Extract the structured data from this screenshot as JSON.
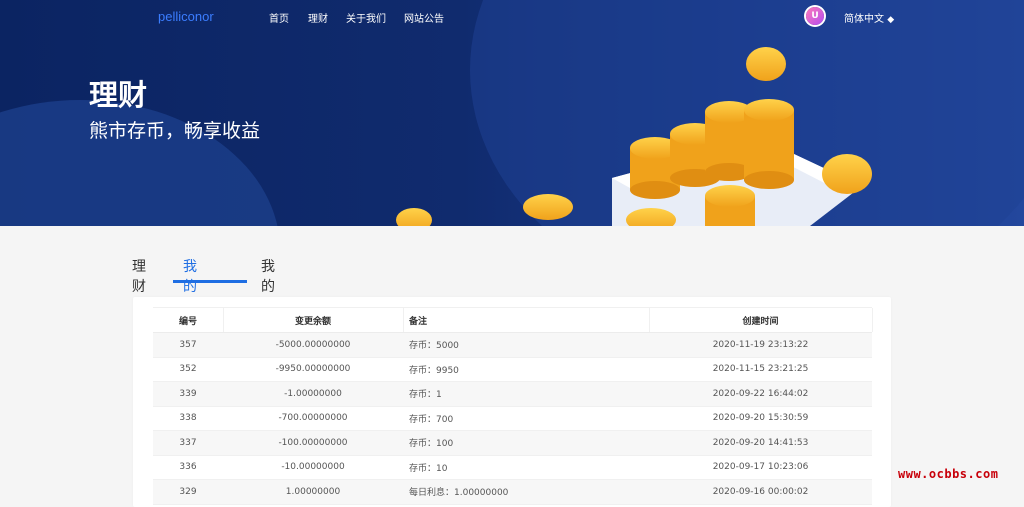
{
  "nav": {
    "logo": "pelliconor",
    "items": [
      "首页",
      "理财",
      "关于我们",
      "网站公告"
    ],
    "language": "简体中文"
  },
  "hero": {
    "title": "理财",
    "subtitle": "熊市存币，畅享收益"
  },
  "tabs": {
    "items": [
      "理财",
      "我的理财",
      "我的订单"
    ],
    "active": "我的理财"
  },
  "table": {
    "headers": [
      "编号",
      "变更余额",
      "备注",
      "创建时间"
    ],
    "rows": [
      [
        "357",
        "-5000.00000000",
        "存币：5000",
        "2020-11-19 23:13:22"
      ],
      [
        "352",
        "-9950.00000000",
        "存币：9950",
        "2020-11-15 23:21:25"
      ],
      [
        "339",
        "-1.00000000",
        "存币：1",
        "2020-09-22 16:44:02"
      ],
      [
        "338",
        "-700.00000000",
        "存币：700",
        "2020-09-20 15:30:59"
      ],
      [
        "337",
        "-100.00000000",
        "存币：100",
        "2020-09-20 14:41:53"
      ],
      [
        "336",
        "-10.00000000",
        "存币：10",
        "2020-09-17 10:23:06"
      ],
      [
        "329",
        "1.00000000",
        "每日利息：1.00000000",
        "2020-09-16 00:00:02"
      ]
    ]
  },
  "watermark": "www.ocbbs.com",
  "colors": {
    "accent": "#1f6ee3",
    "hero_bg": "#102b6e",
    "coin": "#f7b52c"
  }
}
